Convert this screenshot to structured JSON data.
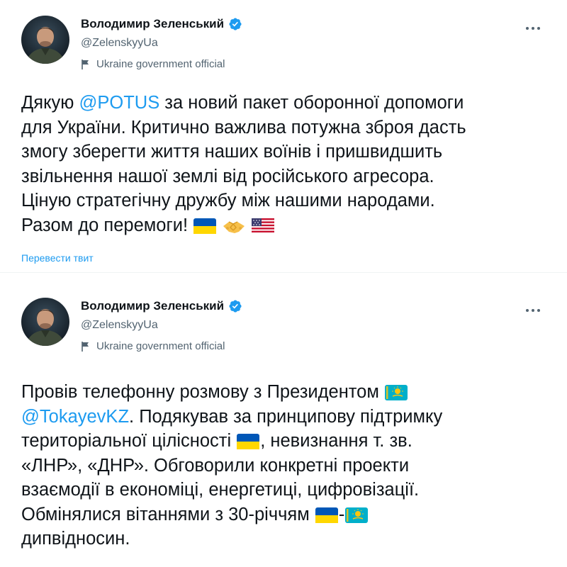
{
  "tweets": [
    {
      "author": {
        "name": "Володимир Зеленський",
        "handle": "@ZelenskyyUa",
        "label": "Ukraine government official"
      },
      "text": {
        "t1": "Дякую ",
        "mention": "@POTUS",
        "t2": " за новий пакет оборонної допомоги\nдля України. Критично важлива потужна зброя дасть\nзмогу зберегти життя наших воїнів і пришвидшить\nзвільнення нашої землі від російського агресора.\nЦіную стратегічну дружбу між нашими народами.\nРазом до перемоги! "
      },
      "emoji": [
        "flag-ukraine-icon",
        "handshake-icon",
        "flag-usa-icon"
      ],
      "translate_label": "Перевести твит"
    },
    {
      "author": {
        "name": "Володимир Зеленський",
        "handle": "@ZelenskyyUa",
        "label": "Ukraine government official"
      },
      "text": {
        "t1": "Провів телефонну розмову з Президентом ",
        "mention": "@TokayevKZ",
        "t2": ". Подякував за принципову підтримку\nтериторіальної цілісності ",
        "t3": ", невизнання т. зв.\n«ЛНР», «ДНР». Обговорили конкретні проекти\nвзаємодії в економіці, енергетиці, цифровізації.\nОбмінялися вітаннями з 30-річчям ",
        "t4": "-",
        "t5": "\nдипвідносин."
      },
      "emoji": [
        "flag-kazakhstan-icon",
        "flag-ukraine-icon",
        "flag-ukraine-icon",
        "flag-kazakhstan-icon"
      ]
    }
  ],
  "colors": {
    "text": "#0f1419",
    "secondary": "#536471",
    "link": "#1d9bf0",
    "verified": "#1d9bf0"
  }
}
